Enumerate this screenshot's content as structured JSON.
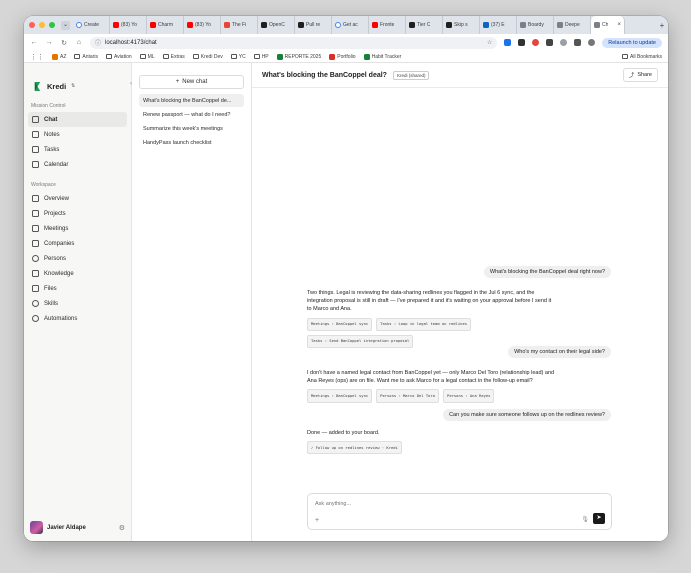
{
  "browser": {
    "tabs": [
      {
        "title": "Create",
        "favicon": "google-icon"
      },
      {
        "title": "(83) Yo",
        "favicon": "youtube-icon"
      },
      {
        "title": "Charm",
        "favicon": "youtube-icon"
      },
      {
        "title": "(83) Yo",
        "favicon": "youtube-icon"
      },
      {
        "title": "The Fi",
        "favicon": "gmail-icon"
      },
      {
        "title": "OpenC",
        "favicon": "github-icon"
      },
      {
        "title": "Pull re",
        "favicon": "github-icon"
      },
      {
        "title": "Get ac",
        "favicon": "google-icon"
      },
      {
        "title": "Fronte",
        "favicon": "youtube-icon"
      },
      {
        "title": "Tier C",
        "favicon": "github-icon"
      },
      {
        "title": "Skip s",
        "favicon": "github-icon"
      },
      {
        "title": "(37) E",
        "favicon": "linkedin-icon"
      },
      {
        "title": "Boardy",
        "favicon": "boardy-icon"
      },
      {
        "title": "Deepe",
        "favicon": "globe-icon"
      },
      {
        "title": "Ch",
        "favicon": "globe-icon",
        "active": true
      }
    ],
    "url": "localhost:4173/chat",
    "relaunch_label": "Relaunch to update",
    "bookmarks": [
      "AZ",
      "Antaris",
      "Aviation",
      "ML",
      "Extras",
      "Kredi Dev",
      "YC",
      "HP",
      "REPORTE 2025",
      "Portfolio",
      "Habit Tracker"
    ],
    "all_bookmarks": "All Bookmarks"
  },
  "sidebar": {
    "brand": "Kredi",
    "mission_label": "Mission Control",
    "mission_items": [
      {
        "label": "Chat",
        "icon": "chat-icon",
        "active": true
      },
      {
        "label": "Notes",
        "icon": "notes-icon"
      },
      {
        "label": "Tasks",
        "icon": "tasks-icon"
      },
      {
        "label": "Calendar",
        "icon": "calendar-icon"
      }
    ],
    "workspace_label": "Workspace",
    "workspace_items": [
      {
        "label": "Overview",
        "icon": "home-icon"
      },
      {
        "label": "Projects",
        "icon": "folder-icon"
      },
      {
        "label": "Meetings",
        "icon": "video-icon"
      },
      {
        "label": "Companies",
        "icon": "building-icon"
      },
      {
        "label": "Persons",
        "icon": "users-icon"
      },
      {
        "label": "Knowledge",
        "icon": "book-icon"
      },
      {
        "label": "Files",
        "icon": "file-icon"
      },
      {
        "label": "Skills",
        "icon": "lightbulb-icon"
      },
      {
        "label": "Automations",
        "icon": "clock-icon"
      }
    ],
    "user_name": "Javier Aldape"
  },
  "chatlist": {
    "new_chat_label": "New chat",
    "items": [
      {
        "title": "What's blocking the BanCoppel de...",
        "active": true
      },
      {
        "title": "Renew passport — what do I need?"
      },
      {
        "title": "Summarize this week's meetings"
      },
      {
        "title": "HandyPass launch checklist"
      }
    ]
  },
  "thread": {
    "title": "What's blocking the BanCoppel deal?",
    "badge": "Kredi (shared)",
    "share_label": "Share",
    "messages": [
      {
        "role": "user",
        "text": "What's blocking the BanCoppel deal right now?"
      },
      {
        "role": "assistant",
        "text": "Two things. Legal is reviewing the data-sharing redlines you flagged in the Jul 6 sync, and the integration proposal is still in draft — I've prepared it and it's waiting on your approval before I send it to Marco and Ana.",
        "chips": [
          "Meetings › BanCoppel sync",
          "Tasks › Loop in legal team on redlines",
          "Tasks › Send BanCoppel integration proposal"
        ]
      },
      {
        "role": "user",
        "text": "Who's my contact on their legal side?"
      },
      {
        "role": "assistant",
        "text": "I don't have a named legal contact from BanCoppel yet — only Marco Del Toro (relationship lead) and Ana Reyes (ops) are on file. Want me to ask Marco for a legal contact in the follow-up email?",
        "chips": [
          "Meetings › BanCoppel sync",
          "Persons › Marco Del Toro",
          "Persons › Ana Reyes"
        ]
      },
      {
        "role": "user",
        "text": "Can you make sure someone follows up on the redlines review?"
      },
      {
        "role": "assistant",
        "text": "Done — added to your board.",
        "chips": [
          "✓ Follow up on redlines review · Kredi"
        ]
      }
    ],
    "composer_placeholder": "Ask anything..."
  }
}
